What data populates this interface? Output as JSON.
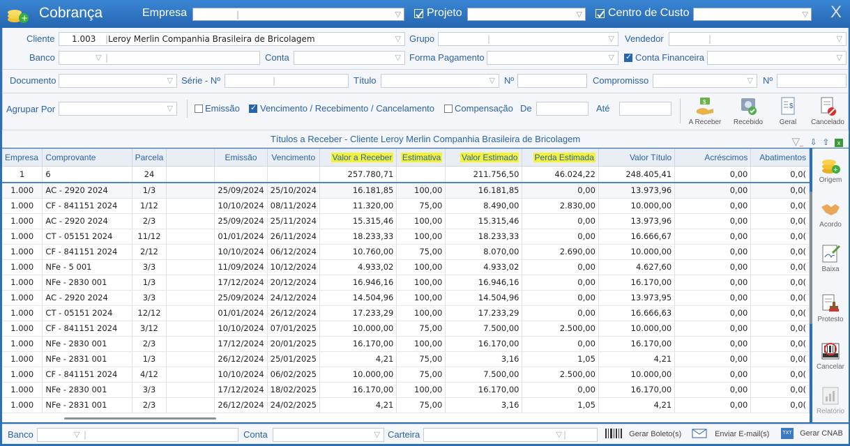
{
  "title": "Cobrança",
  "header": {
    "empresa_label": "Empresa",
    "projeto_label": "Projeto",
    "centro_custo_label": "Centro de Custo",
    "close_label": "X"
  },
  "filters": {
    "cliente_label": "Cliente",
    "cliente_code": "1.003",
    "cliente_name": "Leroy Merlin Companhia Brasileira de Bricolagem",
    "grupo_label": "Grupo",
    "vendedor_label": "Vendedor",
    "banco_label": "Banco",
    "conta_label": "Conta",
    "forma_pagamento_label": "Forma Pagamento",
    "conta_financeira_label": "Conta Financeira",
    "documento_label": "Documento",
    "serie_label": "Série - Nº",
    "titulo_label": "Título",
    "numero_label": "Nº",
    "compromisso_label": "Compromisso",
    "numero2_label": "Nº",
    "agrupar_label": "Agrupar Por",
    "emissao_label": "Emissão",
    "vencimento_label": "Vencimento / Recebimento / Cancelamento",
    "compensacao_label": "Compensação",
    "de_label": "De",
    "ate_label": "Até"
  },
  "status_buttons": [
    "A Receber",
    "Recebido",
    "Geral",
    "Cancelado"
  ],
  "caption": "Títulos a Receber - Cliente Leroy Merlin Companhia Brasileira de Bricolagem",
  "table": {
    "columns": [
      "Empresa",
      "Comprovante",
      "Parcela",
      "",
      "Emissão",
      "Vencimento",
      "Valor a Receber",
      "Estimativa",
      "Valor Estimado",
      "Perda Estimada",
      "Valor Título",
      "Acréscimos",
      "Abatimentos"
    ],
    "totals": [
      "1",
      "6",
      "24",
      "",
      "",
      "",
      "257.780,71",
      "",
      "211.756,50",
      "46.024,22",
      "248.405,41",
      "0,00",
      "0,0("
    ],
    "rows": [
      [
        "1.000",
        "AC - 2920 2024",
        "1/3",
        "",
        "25/09/2024",
        "25/10/2024",
        "16.181,85",
        "100,00",
        "16.181,85",
        "0,00",
        "13.973,96",
        "0,00",
        "0,0("
      ],
      [
        "1.000",
        "CF - 841151 2024",
        "1/12",
        "",
        "10/10/2024",
        "08/11/2024",
        "11.320,00",
        "75,00",
        "8.490,00",
        "2.830,00",
        "10.000,00",
        "0,00",
        "0,0("
      ],
      [
        "1.000",
        "AC - 2920 2024",
        "2/3",
        "",
        "25/09/2024",
        "25/11/2024",
        "15.315,46",
        "100,00",
        "15.315,46",
        "0,00",
        "13.973,96",
        "0,00",
        "0,0("
      ],
      [
        "1.000",
        "CT - 05151 2024",
        "11/12",
        "",
        "01/01/2024",
        "26/11/2024",
        "18.233,33",
        "100,00",
        "18.233,33",
        "0,00",
        "16.666,67",
        "0,00",
        "0,0("
      ],
      [
        "1.000",
        "CF - 841151 2024",
        "2/12",
        "",
        "10/10/2024",
        "06/12/2024",
        "10.760,00",
        "75,00",
        "8.070,00",
        "2.690,00",
        "10.000,00",
        "0,00",
        "0,0("
      ],
      [
        "1.000",
        "NFe - 5 001",
        "3/3",
        "",
        "11/09/2024",
        "10/12/2024",
        "4.933,02",
        "100,00",
        "4.933,02",
        "0,00",
        "4.627,60",
        "0,00",
        "0,0("
      ],
      [
        "1.000",
        "NFe - 2830 001",
        "1/3",
        "",
        "17/12/2024",
        "20/12/2024",
        "16.946,16",
        "100,00",
        "16.946,16",
        "0,00",
        "16.170,00",
        "0,00",
        "0,0("
      ],
      [
        "1.000",
        "AC - 2920 2024",
        "3/3",
        "",
        "25/09/2024",
        "24/12/2024",
        "14.504,96",
        "100,00",
        "14.504,96",
        "0,00",
        "13.973,95",
        "0,00",
        "0,0("
      ],
      [
        "1.000",
        "CT - 05151 2024",
        "12/12",
        "",
        "01/01/2024",
        "26/12/2024",
        "17.233,29",
        "100,00",
        "17.233,29",
        "0,00",
        "16.666,63",
        "0,00",
        "0,0("
      ],
      [
        "1.000",
        "CF - 841151 2024",
        "3/12",
        "",
        "10/10/2024",
        "07/01/2025",
        "10.000,00",
        "75,00",
        "7.500,00",
        "2.500,00",
        "10.000,00",
        "0,00",
        "0,0("
      ],
      [
        "1.000",
        "NFe - 2830 001",
        "2/3",
        "",
        "17/12/2024",
        "20/01/2025",
        "16.170,00",
        "100,00",
        "16.170,00",
        "0,00",
        "16.170,00",
        "0,00",
        "0,0("
      ],
      [
        "1.000",
        "NFe - 2831 001",
        "1/3",
        "",
        "26/12/2024",
        "25/01/2025",
        "4,21",
        "75,00",
        "3,16",
        "1,05",
        "4,21",
        "0,00",
        "0,0("
      ],
      [
        "1.000",
        "CF - 841151 2024",
        "4/12",
        "",
        "10/10/2024",
        "06/02/2025",
        "10.000,00",
        "75,00",
        "7.500,00",
        "2.500,00",
        "10.000,00",
        "0,00",
        "0,0("
      ],
      [
        "1.000",
        "NFe - 2830 001",
        "3/3",
        "",
        "17/12/2024",
        "18/02/2025",
        "16.170,00",
        "100,00",
        "16.170,00",
        "0,00",
        "16.170,00",
        "0,00",
        "0,0("
      ],
      [
        "1.000",
        "NFe - 2831 001",
        "2/3",
        "",
        "26/12/2024",
        "24/02/2025",
        "4,21",
        "75,00",
        "3,16",
        "1,05",
        "4,21",
        "0,00",
        "0,0("
      ]
    ]
  },
  "side_buttons": [
    "Origem",
    "Acordo",
    "Baixa",
    "Protesto",
    "Cancelar",
    "Relatório"
  ],
  "footer": {
    "banco_label": "Banco",
    "conta_label": "Conta",
    "carteira_label": "Carteira",
    "gerar_boletos": "Gerar Boleto(s)",
    "enviar_email": "Enviar E-mail(s)",
    "gerar_cnab": "Gerar CNAB",
    "txt_icon_text": "TXT"
  },
  "colors": {
    "title_bar": "#2566b0",
    "label_blue": "#2a62a8",
    "highlight": "#f2f23c"
  }
}
